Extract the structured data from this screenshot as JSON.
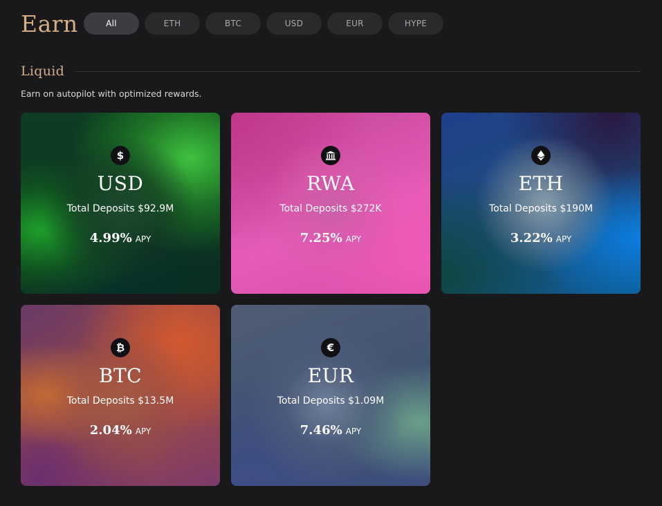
{
  "header": {
    "title": "Earn",
    "tabs": [
      {
        "label": "All",
        "active": true
      },
      {
        "label": "ETH",
        "active": false
      },
      {
        "label": "BTC",
        "active": false
      },
      {
        "label": "USD",
        "active": false
      },
      {
        "label": "EUR",
        "active": false
      },
      {
        "label": "HYPE",
        "active": false
      }
    ]
  },
  "section": {
    "title": "Liquid",
    "subtitle": "Earn on autopilot with optimized rewards."
  },
  "colors": {
    "accent": "#d4ad85",
    "background": "#19191b",
    "tab_bg": "#2a2a2d",
    "tab_active_bg": "#3d3d41"
  },
  "cards": [
    {
      "icon": "dollar-icon",
      "glyph": "$",
      "name": "USD",
      "deposits": "Total Deposits $92.9M",
      "apy_value": "4.99%",
      "apy_label": "APY"
    },
    {
      "icon": "bank-icon",
      "glyph": "",
      "name": "RWA",
      "deposits": "Total Deposits $272K",
      "apy_value": "7.25%",
      "apy_label": "APY"
    },
    {
      "icon": "ethereum-icon",
      "glyph": "",
      "name": "ETH",
      "deposits": "Total Deposits $190M",
      "apy_value": "3.22%",
      "apy_label": "APY"
    },
    {
      "icon": "bitcoin-icon",
      "glyph": "₿",
      "name": "BTC",
      "deposits": "Total Deposits $13.5M",
      "apy_value": "2.04%",
      "apy_label": "APY"
    },
    {
      "icon": "euro-icon",
      "glyph": "€",
      "name": "EUR",
      "deposits": "Total Deposits $1.09M",
      "apy_value": "7.46%",
      "apy_label": "APY"
    }
  ]
}
